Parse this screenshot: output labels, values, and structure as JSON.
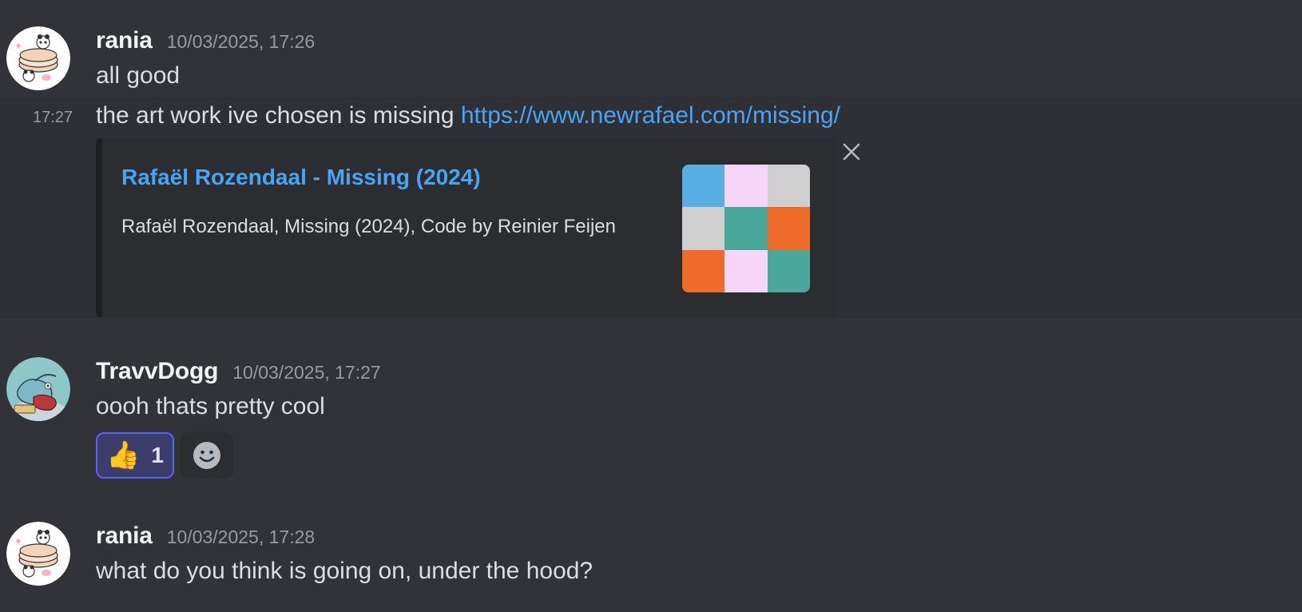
{
  "messages": [
    {
      "username": "rania",
      "timestamp": "10/03/2025, 17:26",
      "text": "all good",
      "avatar_icon": "panda-avatar-icon"
    },
    {
      "side_time": "17:27",
      "text": "the art work ive chosen is missing ",
      "link": "https://www.newrafael.com/missing/",
      "embed": {
        "title": "Rafaël Rozendaal - Missing (2024)",
        "description": "Rafaël Rozendaal, Missing (2024), Code by Reinier Feijen",
        "thumbnail_colors": [
          "#56aee3",
          "#f5d6f8",
          "#cfcfcf",
          "#cfcfcf",
          "#4aa89a",
          "#ee6b2c",
          "#ee6b2c",
          "#f5d6f8",
          "#4aa89a"
        ]
      }
    },
    {
      "username": "TravvDogg",
      "timestamp": "10/03/2025, 17:27",
      "text": "oooh thats pretty cool",
      "avatar_icon": "cartoon-avatar-icon",
      "reactions": [
        {
          "emoji": "👍",
          "emoji_icon": "thumbs-up-icon",
          "count": "1"
        }
      ]
    },
    {
      "username": "rania",
      "timestamp": "10/03/2025, 17:28",
      "text": "what do you think is going on, under the hood?",
      "avatar_icon": "panda-avatar-icon"
    }
  ],
  "colors": {
    "background": "#313338",
    "hover_background": "#2e3035",
    "embed_background": "#2b2d31",
    "link": "#4aa3f5",
    "reaction_border": "#5865f2"
  }
}
